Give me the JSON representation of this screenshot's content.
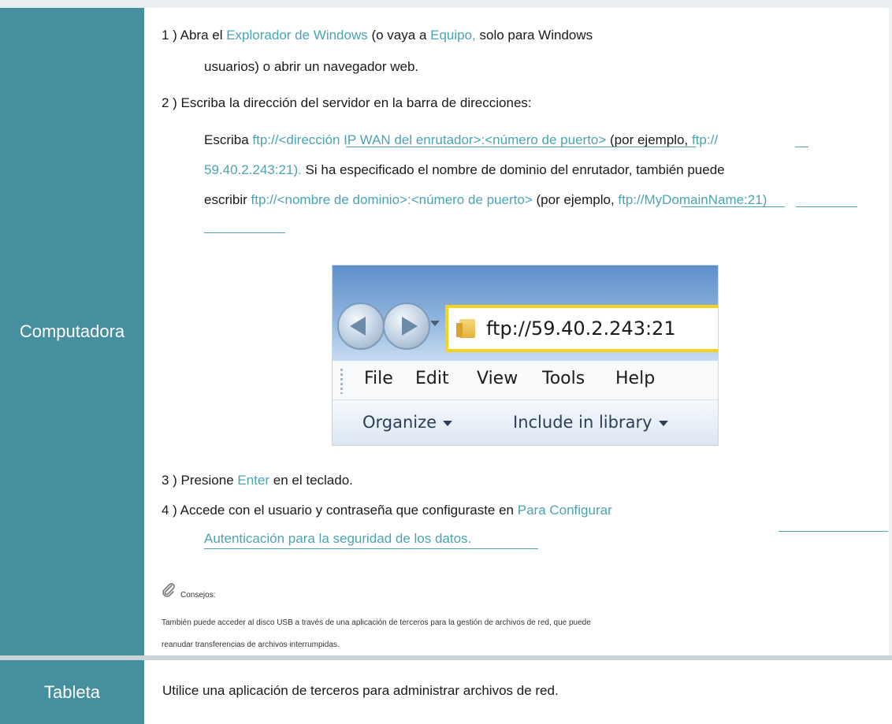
{
  "computer": {
    "label": "Computadora",
    "step1": {
      "num": "1 ) Abra el ",
      "link1": "Explorador de Windows",
      "mid": " (o vaya a ",
      "link2": "Equipo,",
      "end": " solo para Windows",
      "line2": "usuarios) o abrir un navegador web."
    },
    "step2": {
      "text": "2 ) Escriba la dirección del servidor en la barra de direcciones:",
      "p1_a": "Escriba ",
      "p1_link1": "ftp://<dirección IP WAN del enrutador>:<número de puerto>",
      "p1_b": " (por ejemplo, ",
      "p1_link2": "ftp://",
      "p2_link": "59.40.2.243:21).",
      "p2_b": " Si ha especificado el nombre de dominio del enrutador, también puede",
      "p3_a": "escribir ",
      "p3_link1": "ftp://<nombre de dominio>:<número de puerto>",
      "p3_b": " (por ejemplo, ",
      "p3_link2": "ftp://MyDomainName:21)"
    },
    "explorer": {
      "address": "ftp://59.40.2.243:21",
      "menu": [
        "File",
        "Edit",
        "View",
        "Tools",
        "Help"
      ],
      "toolbar": [
        "Organize",
        "Include in library"
      ]
    },
    "step3": {
      "a": "3 ) Presione ",
      "link": "Enter",
      "b": " en el teclado."
    },
    "step4": {
      "a": "4 ) Accede con el usuario y contraseña que configuraste en ",
      "link1": "Para Configurar",
      "link2": "Autenticación para la seguridad de los datos."
    },
    "tips": {
      "label": "Consejos:",
      "line1": "También puede acceder al disco USB a través de una aplicación de terceros para la gestión de archivos de red, que puede",
      "line2": "reanudar transferencias de archivos interrumpidas."
    }
  },
  "tablet": {
    "label": "Tableta",
    "text": "Utilice una aplicación de terceros para administrar archivos de red."
  },
  "colors": {
    "side_background": "#468f9e",
    "link": "#4aa3b4"
  }
}
